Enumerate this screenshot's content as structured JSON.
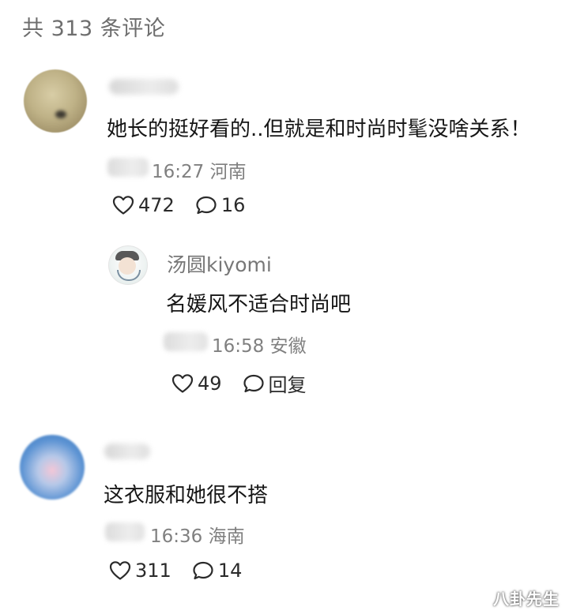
{
  "header": {
    "title": "共 313 条评论"
  },
  "comments": [
    {
      "text": "她长的挺好看的..但就是和时尚时髦没啥关系！",
      "time": "16:27",
      "location": "河南",
      "likes": "472",
      "reply_count": "16"
    },
    {
      "text": "这衣服和她很不搭",
      "time": "16:36",
      "location": "海南",
      "likes": "311",
      "reply_count": "14"
    }
  ],
  "reply": {
    "username": "汤圆kiyomi",
    "text": "名媛风不适合时尚吧",
    "time": "16:58",
    "location": "安徽",
    "likes": "49",
    "reply_label": "回复"
  },
  "watermark": "八卦先生",
  "icons": {
    "like": "heart-outline-icon",
    "comment": "speech-bubble-icon"
  },
  "colors": {
    "text_primary": "#161616",
    "text_secondary": "#808080",
    "icon": "#2a2a2a"
  }
}
